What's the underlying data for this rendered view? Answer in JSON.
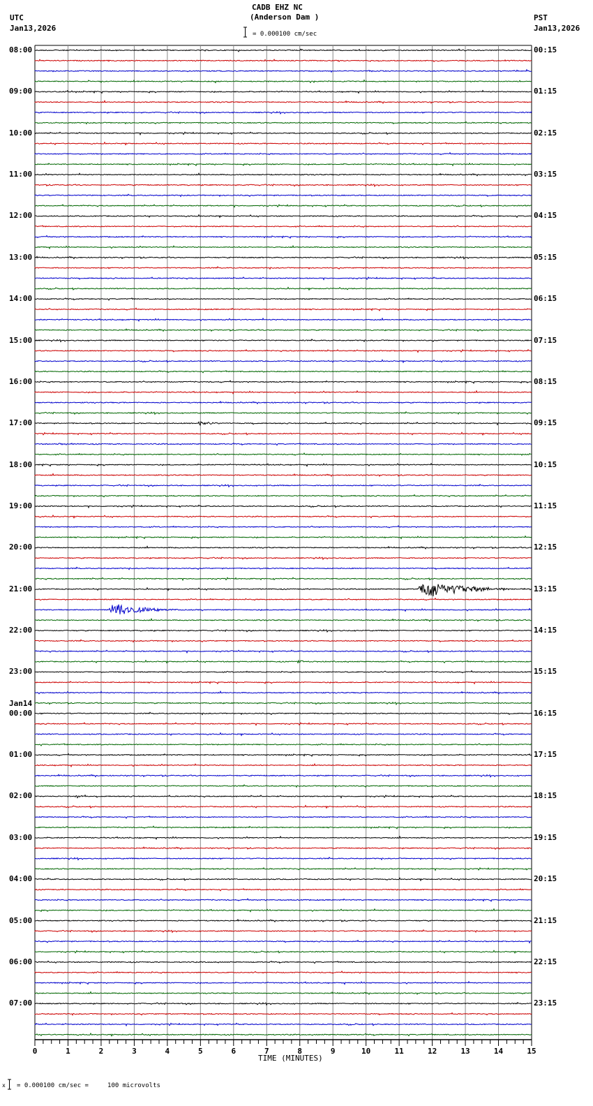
{
  "header": {
    "station": "CADB EHZ NC",
    "location": "(Anderson Dam )",
    "left_zone": "UTC",
    "left_date": "Jan13,2026",
    "right_zone": "PST",
    "right_date": "Jan13,2026",
    "scale_text": "= 0.000100 cm/sec"
  },
  "footer": {
    "scale_text": "= 0.000100 cm/sec =     100 microvolts",
    "marker": "x"
  },
  "chart_data": {
    "type": "line",
    "title": "CADB EHZ NC (Anderson Dam )",
    "xlabel": "TIME (MINUTES)",
    "xlim": [
      0,
      15
    ],
    "x_ticks": [
      "0",
      "1",
      "2",
      "3",
      "4",
      "5",
      "6",
      "7",
      "8",
      "9",
      "10",
      "11",
      "12",
      "13",
      "14",
      "15"
    ],
    "grid": true,
    "traces_per_hour": 4,
    "trace_colors": [
      "#000000",
      "#cc0000",
      "#0000cc",
      "#006600"
    ],
    "left_labels": [
      "08:00",
      "09:00",
      "10:00",
      "11:00",
      "12:00",
      "13:00",
      "14:00",
      "15:00",
      "16:00",
      "17:00",
      "18:00",
      "19:00",
      "20:00",
      "21:00",
      "22:00",
      "23:00",
      "00:00",
      "01:00",
      "02:00",
      "03:00",
      "04:00",
      "05:00",
      "06:00",
      "07:00"
    ],
    "date_change_label": "Jan14",
    "date_change_hour_index": 16,
    "right_labels": [
      "00:15",
      "01:15",
      "02:15",
      "03:15",
      "04:15",
      "05:15",
      "06:15",
      "07:15",
      "08:15",
      "09:15",
      "10:15",
      "11:15",
      "12:15",
      "13:15",
      "14:15",
      "15:15",
      "16:15",
      "17:15",
      "18:15",
      "19:15",
      "20:15",
      "21:15",
      "22:15",
      "23:15"
    ],
    "events": [
      {
        "trace": 20,
        "start_min": 7.8,
        "end_min": 8.1,
        "amplitude": 1.5
      },
      {
        "trace": 36,
        "start_min": 4.9,
        "end_min": 5.8,
        "amplitude": 4
      },
      {
        "trace": 38,
        "start_min": 0.7,
        "end_min": 1.0,
        "amplitude": 1.5
      },
      {
        "trace": 52,
        "start_min": 11.5,
        "end_min": 15.0,
        "amplitude": 12
      },
      {
        "trace": 54,
        "start_min": 2.2,
        "end_min": 4.3,
        "amplitude": 11
      },
      {
        "trace": 58,
        "start_min": 5.8,
        "end_min": 6.2,
        "amplitude": 1.5
      },
      {
        "trace": 59,
        "start_min": 7.8,
        "end_min": 9.0,
        "amplitude": 1.5
      },
      {
        "trace": 72,
        "start_min": 1.2,
        "end_min": 1.7,
        "amplitude": 3
      }
    ]
  }
}
